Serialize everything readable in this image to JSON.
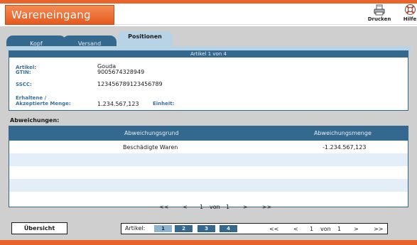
{
  "app": {
    "title": "Wareneingang"
  },
  "toolbar": {
    "print_label": "Drucken",
    "help_label": "Hilfe",
    "print_icon": "printer-icon",
    "help_icon": "lifebuoy-icon"
  },
  "tabs": [
    {
      "label": "Kopf",
      "active": false
    },
    {
      "label": "Versand",
      "active": false
    },
    {
      "label": "Positionen",
      "active": true
    }
  ],
  "article": {
    "header": "Artikel 1 von 4",
    "artikel_label": "Artikel:",
    "artikel_value": "Gouda",
    "gtin_label": "GTIN:",
    "gtin_value": "9005674328949",
    "sscc_label": "SSCC:",
    "sscc_value": "123456789123456789",
    "menge_label_1": "Erhaltene /",
    "menge_label_2": "Akzeptierte Menge:",
    "menge_value": "1.234.567,123",
    "einheit_label": "Einheit:",
    "einheit_value": ""
  },
  "deviations": {
    "label": "Abweichungen:",
    "columns": [
      "Abweichungsgrund",
      "Abweichungsmenge"
    ],
    "rows": [
      {
        "grund": "Beschädigte Waren",
        "menge": "-1.234.567,123"
      },
      {
        "grund": "",
        "menge": ""
      },
      {
        "grund": "",
        "menge": ""
      },
      {
        "grund": "",
        "menge": ""
      },
      {
        "grund": "",
        "menge": ""
      }
    ]
  },
  "pager": {
    "first": "<<",
    "prev": "<",
    "current": "1",
    "of": "von",
    "total": "1",
    "next": ">",
    "last": ">>"
  },
  "footer": {
    "overview_label": "Übersicht",
    "articles_label": "Artikel:",
    "article_buttons": [
      "1",
      "2",
      "3",
      "4"
    ],
    "active_article": "1"
  },
  "colors": {
    "accent": "#e9642a",
    "primary": "#33688f",
    "tab_active": "#b9d3e6",
    "row_alt": "#e3eef8",
    "label_blue": "#3b6fa0"
  }
}
